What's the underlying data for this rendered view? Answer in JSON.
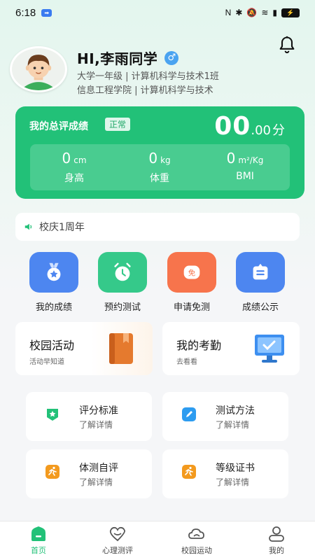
{
  "status_bar": {
    "time": "6:18",
    "battery": "⚡"
  },
  "profile": {
    "name": "HI,李雨同学",
    "gender_symbol": "♂",
    "line1": "大学一年级 | 计算机科学与技术1班",
    "line2": "信息工程学院 | 计算机科学与技术"
  },
  "score_card": {
    "title": "我的总评成绩",
    "status_tag": "正常",
    "score_int": "00",
    "score_dec": ".00",
    "score_unit": "分",
    "metrics": [
      {
        "value": "0",
        "unit": "cm",
        "label": "身高"
      },
      {
        "value": "0",
        "unit": "kg",
        "label": "体重"
      },
      {
        "value": "0",
        "unit": "m²/Kg",
        "label": "BMI"
      }
    ]
  },
  "notice": {
    "text": "校庆1周年"
  },
  "quick_actions": [
    {
      "label": "我的成绩",
      "icon": "medal-icon",
      "color": "#4d86f0"
    },
    {
      "label": "预约测试",
      "icon": "alarm-clock-icon",
      "color": "#35c98a"
    },
    {
      "label": "申请免测",
      "icon": "exempt-icon",
      "color": "#f7744c"
    },
    {
      "label": "成绩公示",
      "icon": "announcement-icon",
      "color": "#4d86f0"
    }
  ],
  "feature_cards": [
    {
      "title": "校园活动",
      "subtitle": "活动早知道",
      "icon": "book-icon"
    },
    {
      "title": "我的考勤",
      "subtitle": "去看看",
      "icon": "monitor-check-icon"
    }
  ],
  "info_cards": [
    {
      "title": "评分标准",
      "subtitle": "了解详情",
      "icon": "star-tag-icon",
      "color": "#22c178"
    },
    {
      "title": "测试方法",
      "subtitle": "了解详情",
      "icon": "edit-icon",
      "color": "#2d9cf0"
    },
    {
      "title": "体测自评",
      "subtitle": "了解详情",
      "icon": "runner-icon",
      "color": "#f39a1e"
    },
    {
      "title": "等级证书",
      "subtitle": "了解详情",
      "icon": "runner-icon",
      "color": "#f39a1e"
    }
  ],
  "bottom_nav": [
    {
      "label": "首页",
      "icon": "home-icon",
      "active": true
    },
    {
      "label": "心理测评",
      "icon": "heart-icon",
      "active": false
    },
    {
      "label": "校园运动",
      "icon": "cloud-run-icon",
      "active": false
    },
    {
      "label": "我的",
      "icon": "user-icon",
      "active": false
    }
  ]
}
